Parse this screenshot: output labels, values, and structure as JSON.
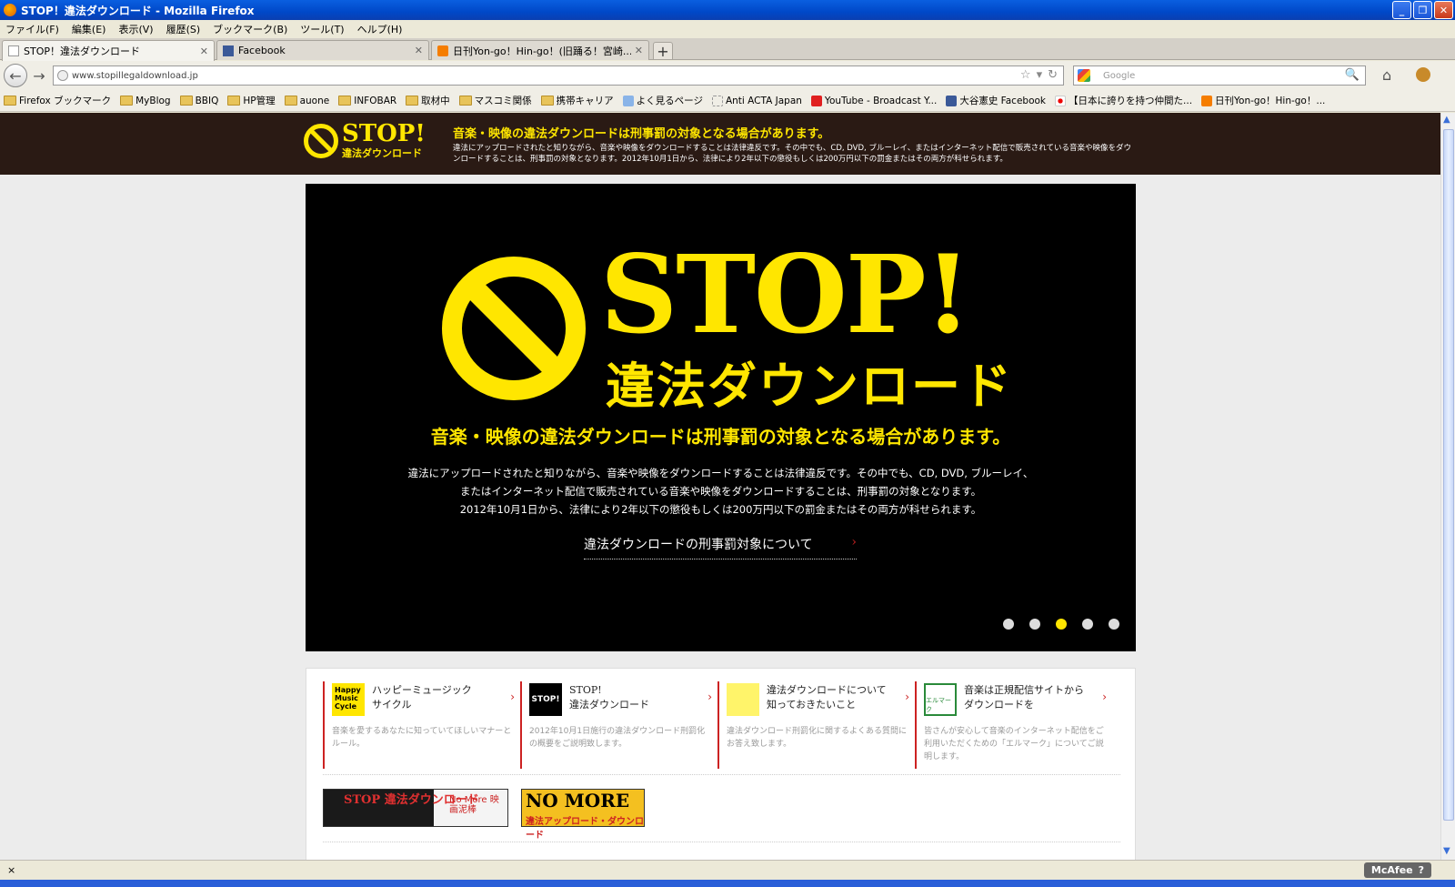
{
  "window": {
    "title": "STOP！違法ダウンロード - Mozilla Firefox",
    "minimize": "_",
    "maximize": "❐",
    "close": "✕"
  },
  "menu": [
    "ファイル(F)",
    "編集(E)",
    "表示(V)",
    "履歴(S)",
    "ブックマーク(B)",
    "ツール(T)",
    "ヘルプ(H)"
  ],
  "tabs": [
    {
      "label": "STOP！違法ダウンロード",
      "close": "✕"
    },
    {
      "label": "Facebook",
      "close": "✕"
    },
    {
      "label": "日刊Yon-go！Hin-go！(旧踊る！宮崎...",
      "close": "✕"
    }
  ],
  "new_tab": "+",
  "nav": {
    "back": "←",
    "forward": "→",
    "url": "www.stopillegaldownload.jp",
    "star": "☆",
    "dropdown": "▾",
    "reload": "↻",
    "search_placeholder": "Google",
    "search_icon": "🔍",
    "home": "⌂"
  },
  "bookmarks": [
    {
      "label": "Firefox ブックマーク",
      "icon": "folder-icon"
    },
    {
      "label": "MyBlog",
      "icon": "folder-icon"
    },
    {
      "label": "BBIQ",
      "icon": "folder-icon"
    },
    {
      "label": "HP管理",
      "icon": "folder-icon"
    },
    {
      "label": "auone",
      "icon": "folder-icon"
    },
    {
      "label": "INFOBAR",
      "icon": "folder-icon"
    },
    {
      "label": "取材中",
      "icon": "folder-icon"
    },
    {
      "label": "マスコミ関係",
      "icon": "folder-icon"
    },
    {
      "label": "携帯キャリア",
      "icon": "folder-icon"
    },
    {
      "label": "よく見るページ",
      "icon": "page-icon"
    },
    {
      "label": "Anti ACTA Japan",
      "icon": "page-icon"
    },
    {
      "label": "YouTube - Broadcast Y...",
      "icon": "youtube-icon"
    },
    {
      "label": "大谷憲史 Facebook",
      "icon": "facebook-icon"
    },
    {
      "label": "【日本に誇りを持つ仲間た...",
      "icon": "flag-icon"
    },
    {
      "label": "日刊Yon-go！Hin-go！...",
      "icon": "blogger-icon"
    }
  ],
  "site": {
    "top_banner": {
      "stop": "STOP!",
      "sub": "違法ダウンロード",
      "headline": "音楽・映像の違法ダウンロードは刑事罰の対象となる場合があります。",
      "body": "違法にアップロードされたと知りながら、音楽や映像をダウンロードすることは法律違反です。その中でも、CD, DVD, ブルーレイ、またはインターネット配信で販売されている音楽や映像をダウンロードすることは、刑事罰の対象となります。2012年10月1日から、法律により2年以下の懲役もしくは200万円以下の罰金またはその両方が科せられます。"
    },
    "hero": {
      "stop": "STOP!",
      "sub": "違法ダウンロード",
      "headline": "音楽・映像の違法ダウンロードは刑事罰の対象となる場合があります。",
      "body_line1": "違法にアップロードされたと知りながら、音楽や映像をダウンロードすることは法律違反です。その中でも、CD, DVD, ブルーレイ、",
      "body_line2": "またはインターネット配信で販売されている音楽や映像をダウンロードすることは、刑事罰の対象となります。",
      "body_line3": "2012年10月1日から、法律により2年以下の懲役もしくは200万円以下の罰金またはその両方が科せられます。",
      "link": "違法ダウンロードの刑事罰対象について",
      "link_chevron": "›",
      "slide_count": 5,
      "active_slide": 3
    },
    "cards": [
      {
        "title_line1": "ハッピーミュージック",
        "title_line2": "サイクル",
        "desc": "音楽を愛するあなたに知っていてほしいマナーとルール。",
        "icon_text": "Happy Music Cycle"
      },
      {
        "title_line1": "STOP!",
        "title_line2": "違法ダウンロード",
        "desc": "2012年10月1日施行の違法ダウンロード刑罰化の概要をご説明致します。",
        "icon_text": "STOP!"
      },
      {
        "title_line1": "違法ダウンロードについて",
        "title_line2": "知っておきたいこと",
        "desc": "違法ダウンロード刑罰化に関するよくある質問にお答え致します。",
        "icon_text": ""
      },
      {
        "title_line1": "音楽は正規配信サイトから",
        "title_line2": "ダウンロードを",
        "desc": "皆さんが安心して音楽のインターネット配信をご利用いただくための「エルマーク」についてご説明します。",
        "icon_text": "エルマーク"
      }
    ],
    "banner1": {
      "main": "STOP 違法ダウンロード",
      "side": "No More 映画泥棒"
    },
    "banner2": {
      "main": "NO MORE",
      "sub": "違法アップロード・ダウンロード"
    }
  },
  "status": {
    "text": "×",
    "mcafee": "McAfee",
    "help": "?"
  },
  "colors": {
    "accent_yellow": "#ffe600",
    "accent_red": "#cc2222",
    "banner_bg": "#2a1a14"
  }
}
